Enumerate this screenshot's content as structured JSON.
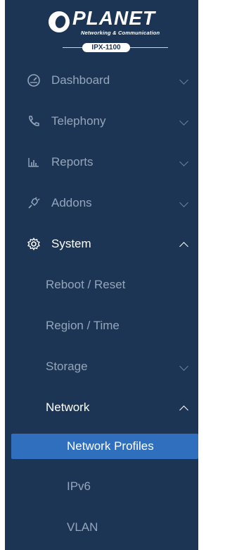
{
  "brand": {
    "name": "PLANET",
    "tagline": "Networking & Communication",
    "model": "IPX-1100"
  },
  "sidebar": {
    "items": [
      {
        "label": "Dashboard",
        "icon": "speedometer-icon",
        "expanded": false
      },
      {
        "label": "Telephony",
        "icon": "phone-icon",
        "expanded": false
      },
      {
        "label": "Reports",
        "icon": "bar-chart-icon",
        "expanded": false
      },
      {
        "label": "Addons",
        "icon": "plug-icon",
        "expanded": false
      },
      {
        "label": "System",
        "icon": "gear-icon",
        "expanded": true
      }
    ],
    "system_children": [
      {
        "label": "Reboot / Reset"
      },
      {
        "label": "Region / Time"
      },
      {
        "label": "Storage",
        "expanded": false
      },
      {
        "label": "Network",
        "expanded": true
      }
    ],
    "network_children": [
      {
        "label": "Network Profiles",
        "selected": true
      },
      {
        "label": "IPv6"
      },
      {
        "label": "VLAN"
      }
    ]
  },
  "colors": {
    "sidebar_bg": "#1c3554",
    "selected_bg": "#2f6fbd",
    "muted_text": "#95a6bb",
    "active_text": "#ffffff"
  }
}
